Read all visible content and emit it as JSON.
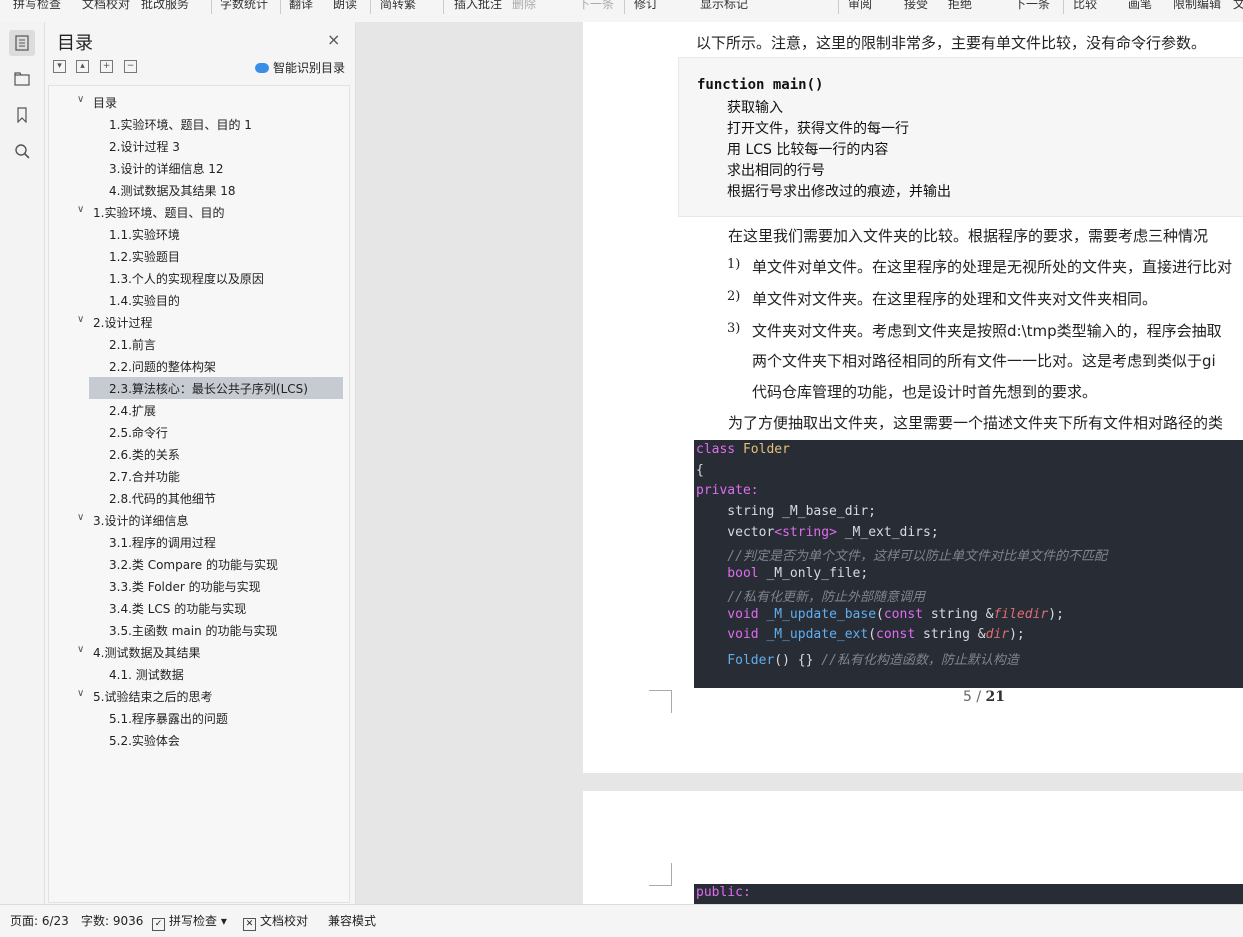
{
  "toolbar": {
    "items": [
      "拼写检查",
      "文档校对",
      "批改服务",
      "字数统计",
      "翻译",
      "朗读",
      "简转繁",
      "插入批注",
      "删除",
      "下一条",
      "修订",
      "显示标记",
      "审阅",
      "接受",
      "拒绝",
      "下一条",
      "比较",
      "画笔",
      "限制编辑",
      "文"
    ]
  },
  "toc": {
    "title": "目录",
    "close": "×",
    "smart_button": "智能识别目录",
    "items": [
      {
        "label": "目录",
        "level": 1,
        "expanded": true
      },
      {
        "label": "1.实验环境、题目、目的 1",
        "level": 2
      },
      {
        "label": "2.设计过程 3",
        "level": 2
      },
      {
        "label": "3.设计的详细信息 12",
        "level": 2
      },
      {
        "label": "4.测试数据及其结果 18",
        "level": 2
      },
      {
        "label": "1.实验环境、题目、目的",
        "level": 1,
        "expanded": true
      },
      {
        "label": "1.1.实验环境",
        "level": 2
      },
      {
        "label": "1.2.实验题目",
        "level": 2
      },
      {
        "label": "1.3.个人的实现程度以及原因",
        "level": 2
      },
      {
        "label": "1.4.实验目的",
        "level": 2
      },
      {
        "label": "2.设计过程",
        "level": 1,
        "expanded": true
      },
      {
        "label": "2.1.前言",
        "level": 2
      },
      {
        "label": "2.2.问题的整体构架",
        "level": 2
      },
      {
        "label": "2.3.算法核心：最长公共子序列(LCS)",
        "level": 2,
        "selected": true
      },
      {
        "label": "2.4.扩展",
        "level": 2
      },
      {
        "label": "2.5.命令行",
        "level": 2
      },
      {
        "label": "2.6.类的关系",
        "level": 2
      },
      {
        "label": "2.7.合并功能",
        "level": 2
      },
      {
        "label": "2.8.代码的其他细节",
        "level": 2
      },
      {
        "label": "3.设计的详细信息",
        "level": 1,
        "expanded": true
      },
      {
        "label": "3.1.程序的调用过程",
        "level": 2
      },
      {
        "label": "3.2.类 Compare 的功能与实现",
        "level": 2
      },
      {
        "label": "3.3.类 Folder 的功能与实现",
        "level": 2
      },
      {
        "label": "3.4.类 LCS 的功能与实现",
        "level": 2
      },
      {
        "label": "3.5.主函数 main 的功能与实现",
        "level": 2
      },
      {
        "label": "4.测试数据及其结果",
        "level": 1,
        "expanded": true
      },
      {
        "label": "4.1. 测试数据",
        "level": 2
      },
      {
        "label": "5.试验结束之后的思考",
        "level": 1,
        "expanded": true
      },
      {
        "label": "5.1.程序暴露出的问题",
        "level": 2
      },
      {
        "label": "5.2.实验体会",
        "level": 2
      }
    ]
  },
  "doc": {
    "line_top": "以下所示。注意，这里的限制非常多，主要有单文件比较，没有命令行参数。",
    "pseudo": [
      "function main()",
      "获取输入",
      "打开文件，获得文件的每一行",
      "用 LCS 比较每一行的内容",
      "求出相同的行号",
      "根据行号求出修改过的痕迹，并输出"
    ],
    "para1": "在这里我们需要加入文件夹的比较。根据程序的要求，需要考虑三种情况",
    "list": [
      {
        "num": "1)",
        "text": "单文件对单文件。在这里程序的处理是无视所处的文件夹，直接进行比对"
      },
      {
        "num": "2)",
        "text": "单文件对文件夹。在这里程序的处理和文件夹对文件夹相同。"
      },
      {
        "num": "3)",
        "text": "文件夹对文件夹。考虑到文件夹是按照d:\\tmp类型输入的，程序会抽取"
      }
    ],
    "list3_cont": [
      "两个文件夹下相对路径相同的所有文件一一比对。这是考虑到类似于gi",
      "代码仓库管理的功能，也是设计时首先想到的要求。"
    ],
    "para2": "为了方便抽取出文件夹，这里需要一个描述文件夹下所有文件相对路径的类",
    "code": {
      "l1_kw": "class",
      "l1_name": "Folder",
      "l2": "{",
      "l3": "private:",
      "l4": "    string _M_base_dir;",
      "l5_a": "    vector",
      "l5_b": "<string>",
      "l5_c": " _M_ext_dirs;",
      "l6": "    //判定是否为单个文件，这样可以防止单文件对比单文件的不匹配",
      "l7_kw": "    bool",
      "l7_rest": " _M_only_file;",
      "l8": "    //私有化更新，防止外部随意调用",
      "l9_kw": "    void",
      "l9_fn": " _M_update_base",
      "l9_p1": "(",
      "l9_const": "const",
      "l9_mid": " string &",
      "l9_param": "filedir",
      "l9_end": ");",
      "l10_kw": "    void",
      "l10_fn": " _M_update_ext",
      "l10_p1": "(",
      "l10_const": "const",
      "l10_mid": " string &",
      "l10_param": "dir",
      "l10_end": ");",
      "l11_fn": "    Folder",
      "l11_mid": "() {} ",
      "l11_cm": "//私有化构造函数，防止默认构造",
      "next_page": "public:"
    },
    "page_current": "5",
    "page_sep": "/",
    "page_total": "21"
  },
  "status": {
    "page": "页面: 6/23",
    "words": "字数: 9036",
    "spell": "拼写检查",
    "proof": "文档校对",
    "compat": "兼容模式"
  }
}
